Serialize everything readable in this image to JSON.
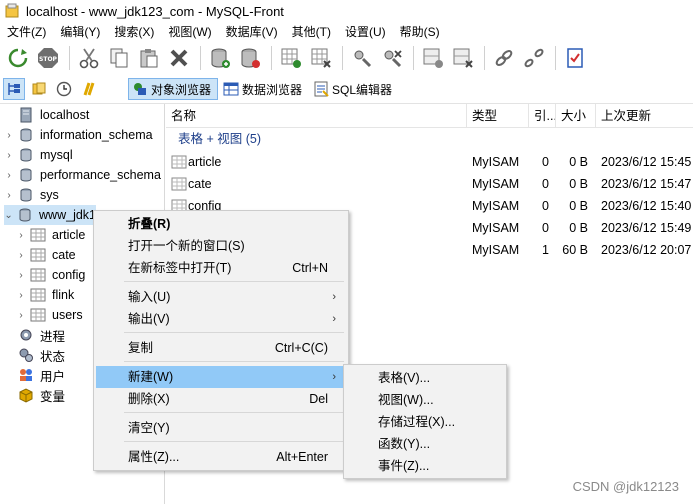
{
  "window": {
    "title": "localhost - www_jdk123_com - MySQL-Front"
  },
  "menubar": {
    "items": [
      "文件(Z)",
      "编辑(Y)",
      "搜索(X)",
      "视图(W)",
      "数据库(V)",
      "其他(T)",
      "设置(U)",
      "帮助(S)"
    ]
  },
  "toolbar": {
    "icons": [
      "refresh-icon",
      "stop-icon",
      "cut-icon",
      "copy-icon",
      "paste-icon",
      "delete-icon",
      "new-database-icon",
      "drop-database-icon",
      "new-table-icon",
      "drop-table-icon",
      "add-user-icon",
      "remove-user-icon",
      "new-field-icon",
      "drop-field-icon",
      "link-icon",
      "unlink-icon",
      "checklist-icon"
    ]
  },
  "viewbar": {
    "tabs": [
      "对象浏览器",
      "数据浏览器",
      "SQL编辑器"
    ]
  },
  "tree": {
    "items": [
      {
        "label": "localhost",
        "icon": "server-icon",
        "level": 0,
        "chevron": ""
      },
      {
        "label": "information_schema",
        "icon": "database-icon",
        "level": 0,
        "chevron": "›"
      },
      {
        "label": "mysql",
        "icon": "database-icon",
        "level": 0,
        "chevron": "›"
      },
      {
        "label": "performance_schema",
        "icon": "database-icon",
        "level": 0,
        "chevron": "›"
      },
      {
        "label": "sys",
        "icon": "database-icon",
        "level": 0,
        "chevron": "›"
      },
      {
        "label": "www_jdk1",
        "icon": "database-icon",
        "level": 0,
        "chevron": "⌄",
        "selected": true
      },
      {
        "label": "article",
        "icon": "table-icon",
        "level": 1,
        "chevron": "›"
      },
      {
        "label": "cate",
        "icon": "table-icon",
        "level": 1,
        "chevron": "›"
      },
      {
        "label": "config",
        "icon": "table-icon",
        "level": 1,
        "chevron": "›"
      },
      {
        "label": "flink",
        "icon": "table-icon",
        "level": 1,
        "chevron": "›"
      },
      {
        "label": "users",
        "icon": "table-icon",
        "level": 1,
        "chevron": "›"
      },
      {
        "label": "进程",
        "icon": "process-icon",
        "level": 0,
        "chevron": ""
      },
      {
        "label": "状态",
        "icon": "status-icon",
        "level": 0,
        "chevron": ""
      },
      {
        "label": "用户",
        "icon": "users-icon",
        "level": 0,
        "chevron": ""
      },
      {
        "label": "变量",
        "icon": "variables-icon",
        "level": 0,
        "chevron": ""
      }
    ]
  },
  "list": {
    "columns": [
      "名称",
      "类型",
      "引...",
      "大小",
      "上次更新"
    ],
    "group": "表格 + 视图 (5)",
    "rows": [
      {
        "name": "article",
        "type": "MyISAM",
        "rows": "0",
        "size": "0 B",
        "updated": "2023/6/12 15:45"
      },
      {
        "name": "cate",
        "type": "MyISAM",
        "rows": "0",
        "size": "0 B",
        "updated": "2023/6/12 15:47"
      },
      {
        "name": "config",
        "type": "MyISAM",
        "rows": "0",
        "size": "0 B",
        "updated": "2023/6/12 15:40"
      },
      {
        "name": "",
        "type": "MyISAM",
        "rows": "0",
        "size": "0 B",
        "updated": "2023/6/12 15:49"
      },
      {
        "name": "",
        "type": "MyISAM",
        "rows": "1",
        "size": "60 B",
        "updated": "2023/6/12 20:07"
      }
    ]
  },
  "context_menu": {
    "items": [
      {
        "label": "折叠(R)",
        "shortcut": "",
        "submenu": false,
        "bold": true
      },
      {
        "label": "打开一个新的窗口(S)",
        "shortcut": "",
        "submenu": false
      },
      {
        "label": "在新标签中打开(T)",
        "shortcut": "Ctrl+N",
        "submenu": false
      },
      {
        "label": "输入(U)",
        "shortcut": "",
        "submenu": true
      },
      {
        "label": "输出(V)",
        "shortcut": "",
        "submenu": true
      },
      {
        "label": "复制",
        "shortcut": "Ctrl+C(C)",
        "submenu": false
      },
      {
        "label": "新建(W)",
        "shortcut": "",
        "submenu": true,
        "highlighted": true
      },
      {
        "label": "删除(X)",
        "shortcut": "Del",
        "submenu": false
      },
      {
        "label": "清空(Y)",
        "shortcut": "",
        "submenu": false
      },
      {
        "label": "属性(Z)...",
        "shortcut": "Alt+Enter",
        "submenu": false
      }
    ]
  },
  "submenu": {
    "items": [
      "表格(V)...",
      "视图(W)...",
      "存储过程(X)...",
      "函数(Y)...",
      "事件(Z)..."
    ]
  },
  "watermark": "CSDN @jdk12123",
  "colors": {
    "selection": "#cce4f7",
    "menu_highlight": "#91c9f7",
    "group_text": "#1e3f8a"
  }
}
